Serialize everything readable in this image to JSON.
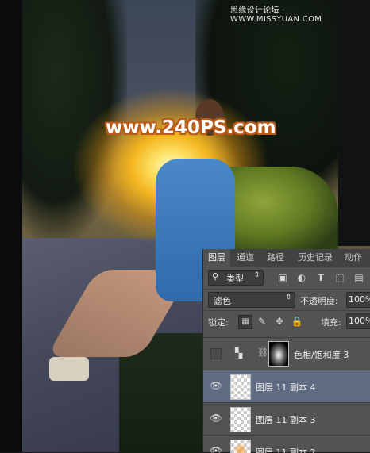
{
  "watermark": {
    "text": "www.240PS.com"
  },
  "site_mark": {
    "left": "思缘设计论坛",
    "sep": "·",
    "right": "WWW.MISSYUAN.COM"
  },
  "panel": {
    "tabs": [
      "图层",
      "通道",
      "路径",
      "历史记录",
      "动作"
    ],
    "active_tab": "图层",
    "filter": {
      "label": "类型",
      "icons": [
        "image-filter-icon",
        "adjust-filter-icon",
        "type-filter-icon",
        "shape-filter-icon",
        "smart-filter-icon"
      ]
    },
    "blend_mode": "滤色",
    "opacity_label": "不透明度:",
    "opacity_value": "100%",
    "lock_label": "锁定:",
    "fill_label": "填充:",
    "fill_value": "100%",
    "layers": [
      {
        "name": "色相/饱和度 3",
        "visible": false,
        "type": "adjustment",
        "selected": false
      },
      {
        "name": "图层 11 副本 4",
        "visible": true,
        "type": "pixel",
        "selected": true
      },
      {
        "name": "图层 11 副本 3",
        "visible": true,
        "type": "pixel",
        "selected": false
      },
      {
        "name": "图层 11 副本 2",
        "visible": true,
        "type": "pixel",
        "selected": false
      }
    ]
  }
}
